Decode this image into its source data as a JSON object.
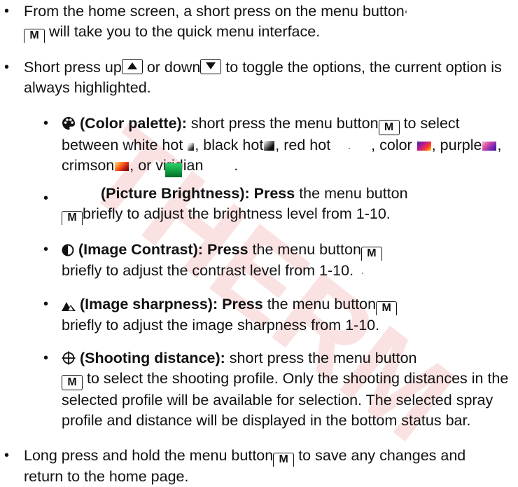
{
  "watermark": {
    "text": "THERM"
  },
  "bullets": {
    "symbol": "•"
  },
  "keys": {
    "menu": "M"
  },
  "icons": {
    "palette": "palette-icon",
    "brightness": "sun-icon",
    "contrast": "half-circle-icon",
    "sharpness": "mountain-icon",
    "distance": "crosshair-icon"
  },
  "colors": {
    "text": "#111111",
    "watermark": "#f8caca",
    "viridian_swatch": "#1aa64a"
  },
  "list": {
    "home": {
      "part1": "From the home screen, a short press on the menu button",
      "part2": "will take you to the quick menu interface."
    },
    "toggle": {
      "part1": "Short press up",
      "part2": "or down",
      "part3": "to toggle the options, the current option is always highlighted."
    },
    "palette": {
      "title": "(Color palette):",
      "part1": "short press the menu button",
      "part2": "to select between white hot",
      "part3": ", black hot",
      "part4": ", red hot",
      "part5": ", color",
      "part6": ", purple",
      "part7": ", crimson",
      "part8": ", or viridian",
      "part9": "."
    },
    "brightness": {
      "title": "(Picture Brightness):",
      "lead": "Press",
      "part1": "the menu button",
      "part2": "briefly to adjust the brightness level from 1-10."
    },
    "contrast": {
      "title": "(Image Contrast):",
      "lead": "Press",
      "part1": "the menu button",
      "part2": "briefly to adjust the contrast level from 1-10."
    },
    "sharpness": {
      "title": "(Image sharpness):",
      "lead": "Press",
      "part1": "the menu button",
      "part2": "briefly to adjust the image sharpness from 1-10."
    },
    "distance": {
      "title": "(Shooting distance):",
      "part1": "short press the menu button",
      "part2": "to select the shooting profile. Only the shooting distances in the selected profile will be available for selection. The selected spray profile and distance will be displayed in the bottom status bar."
    },
    "save": {
      "part1": "Long press and hold the menu button",
      "part2": "to save any changes and return to the home page."
    }
  }
}
